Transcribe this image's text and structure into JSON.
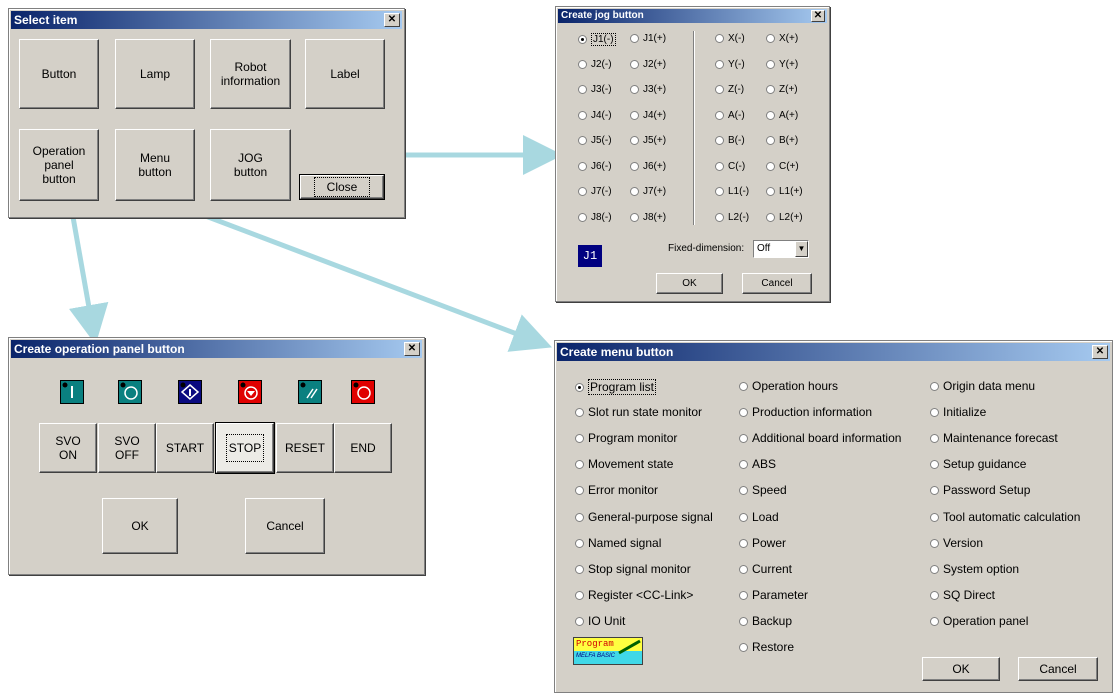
{
  "select_item": {
    "title": "Select item",
    "buttons": {
      "button": "Button",
      "lamp": "Lamp",
      "robot_info_line1": "Robot",
      "robot_info_line2": "information",
      "label": "Label",
      "op_line1": "Operation",
      "op_line2": "panel",
      "op_line3": "button",
      "menu_line1": "Menu",
      "menu_line2": "button",
      "jog_line1": "JOG",
      "jog_line2": "button",
      "close": "Close"
    }
  },
  "jog": {
    "title": "Create jog button",
    "col1": [
      "J1(-)",
      "J2(-)",
      "J3(-)",
      "J4(-)",
      "J5(-)",
      "J6(-)",
      "J7(-)",
      "J8(-)"
    ],
    "col2": [
      "J1(+)",
      "J2(+)",
      "J3(+)",
      "J4(+)",
      "J5(+)",
      "J6(+)",
      "J7(+)",
      "J8(+)"
    ],
    "col3": [
      "X(-)",
      "Y(-)",
      "Z(-)",
      "A(-)",
      "B(-)",
      "C(-)",
      "L1(-)",
      "L2(-)"
    ],
    "col4": [
      "X(+)",
      "Y(+)",
      "Z(+)",
      "A(+)",
      "B(+)",
      "C(+)",
      "L1(+)",
      "L2(+)"
    ],
    "selected": "J1(-)",
    "preview": "J1",
    "fixed_label": "Fixed-dimension:",
    "fixed_value": "Off",
    "ok": "OK",
    "cancel": "Cancel"
  },
  "operation": {
    "title": "Create operation panel button",
    "buttons": [
      {
        "line1": "SVO",
        "line2": "ON"
      },
      {
        "line1": "SVO",
        "line2": "OFF"
      },
      {
        "line1": "START",
        "line2": ""
      },
      {
        "line1": "STOP",
        "line2": ""
      },
      {
        "line1": "RESET",
        "line2": ""
      },
      {
        "line1": "END",
        "line2": ""
      }
    ],
    "icon_colors": [
      "#0a8080",
      "#0a8080",
      "#0a0a80",
      "#e00000",
      "#0a8080",
      "#e00000"
    ],
    "ok": "OK",
    "cancel": "Cancel"
  },
  "menu": {
    "title": "Create menu button",
    "col1": [
      "Program list",
      "Slot run state monitor",
      "Program monitor",
      "Movement state",
      "Error monitor",
      "General-purpose signal",
      "Named signal",
      "Stop signal monitor",
      "Register <CC-Link>",
      "IO Unit"
    ],
    "col2": [
      "Operation hours",
      "Production information",
      "Additional board information",
      "ABS",
      "Speed",
      "Load",
      "Power",
      "Current",
      "Parameter",
      "Backup",
      "Restore"
    ],
    "col3": [
      "Origin data menu",
      "Initialize",
      "Maintenance forecast",
      "Setup guidance",
      "Password Setup",
      "Tool automatic calculation",
      "Version",
      "System option",
      "SQ Direct",
      "Operation panel"
    ],
    "selected": "Program list",
    "logo_line1": "Program",
    "logo_line2": "MELFA BASIC",
    "ok": "OK",
    "cancel": "Cancel"
  },
  "colors": {
    "arrow": "#a8d8e0",
    "dialog_bg": "#d4d0c8",
    "title_start": "#0a246a",
    "title_end": "#a6caf0"
  }
}
